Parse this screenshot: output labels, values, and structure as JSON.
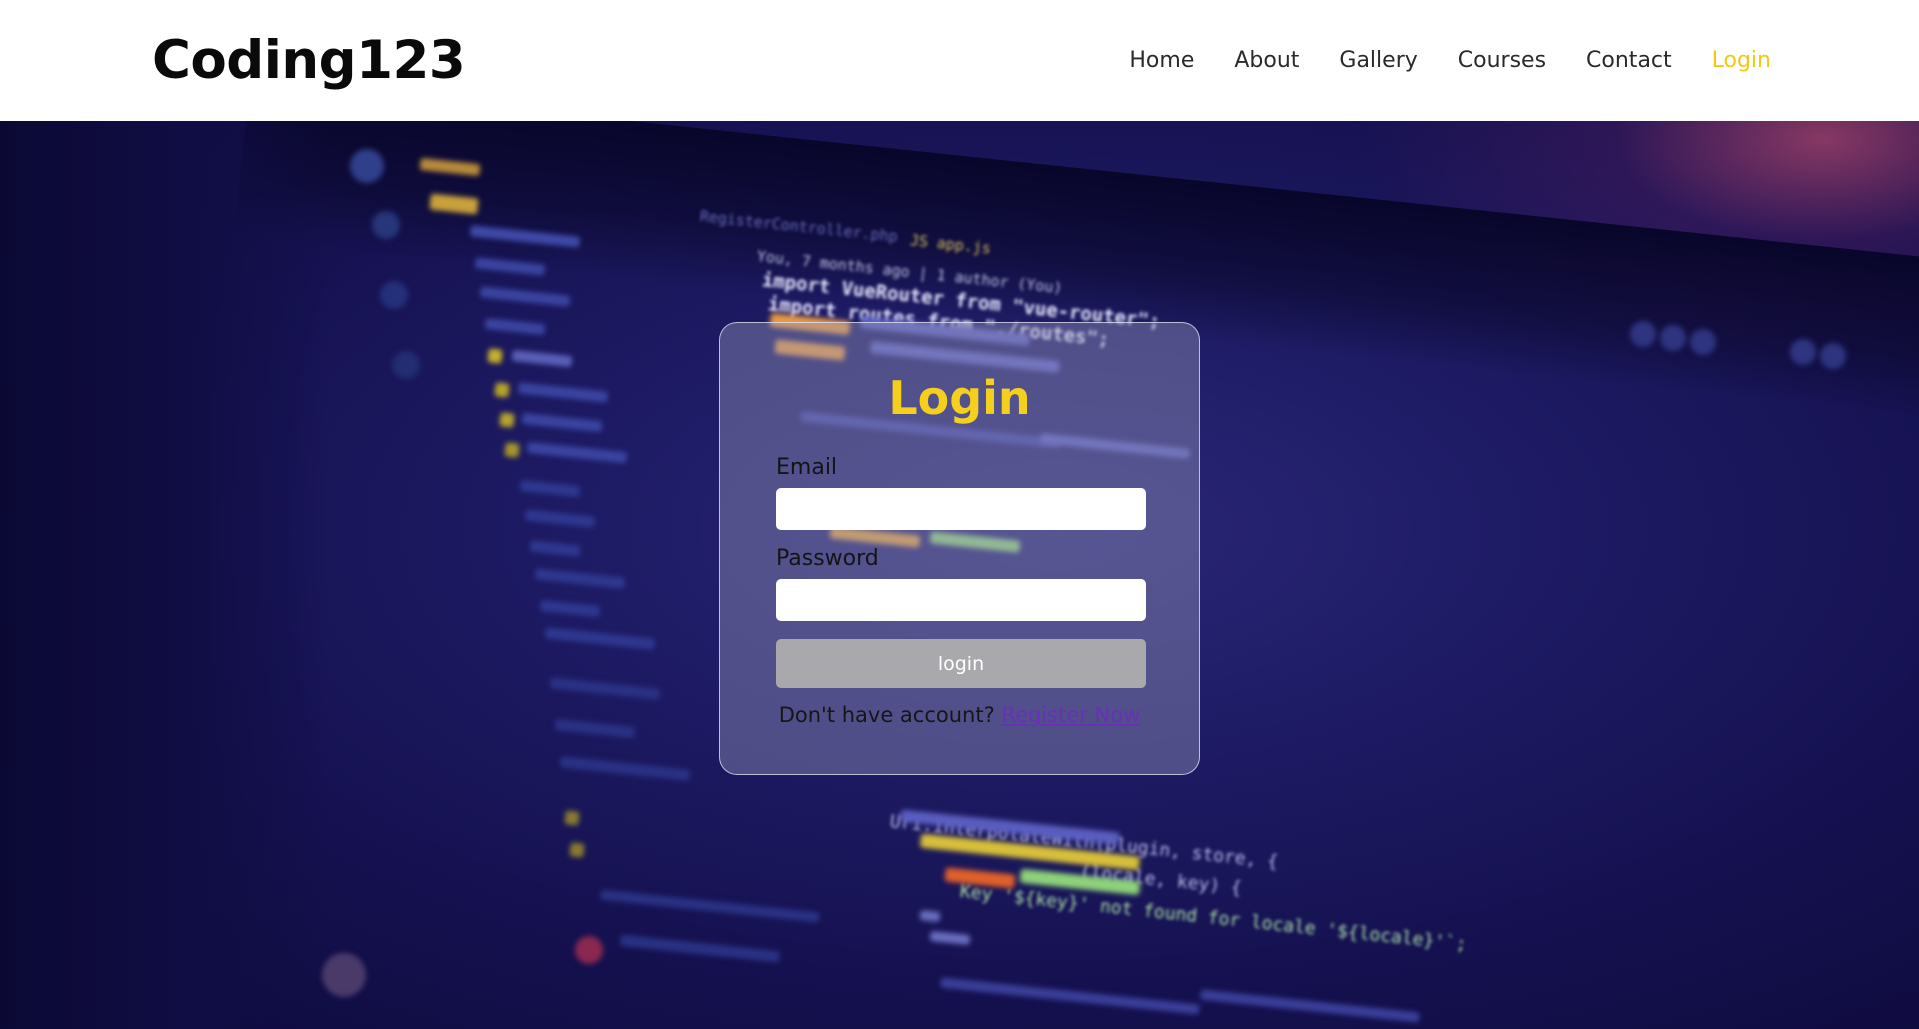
{
  "header": {
    "brand": "Coding123",
    "nav": [
      {
        "label": "Home"
      },
      {
        "label": "About"
      },
      {
        "label": "Gallery"
      },
      {
        "label": "Courses"
      },
      {
        "label": "Contact"
      },
      {
        "label": "Login",
        "active": true
      }
    ]
  },
  "background": {
    "tabs": [
      "RegisterController.php",
      "JS app.js"
    ],
    "git_blame": "You, 7 months ago | 1 author (You)",
    "code": [
      "import VueRouter from \"vue-router\";",
      "import routes from \"./routes\";",
      "Uri.interpolateWith(plugin, store, {",
      "    (locale, key) {",
      "    Key '${key}' not found for locale '${locale}'`;"
    ]
  },
  "login": {
    "title": "Login",
    "email_label": "Email",
    "email_value": "",
    "password_label": "Password",
    "password_value": "",
    "submit_label": "login",
    "register_prompt": "Don't have account?",
    "register_link": "Register Now"
  },
  "colors": {
    "accent": "#f5cf1d",
    "link": "#6a2fb8",
    "button": "#a9a9ad",
    "hero": "#1d1a63"
  }
}
